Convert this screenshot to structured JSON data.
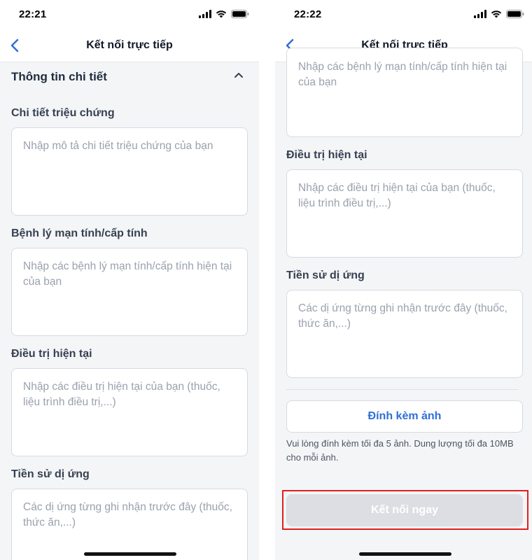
{
  "left": {
    "status": {
      "time": "22:21"
    },
    "nav": {
      "title": "Kết nối trực tiếp"
    },
    "section": {
      "title": "Thông tin chi tiết"
    },
    "fields": [
      {
        "label": "Chi tiết triệu chứng",
        "placeholder": "Nhập mô tả chi tiết triệu chứng của bạn"
      },
      {
        "label": "Bệnh lý mạn tính/cấp tính",
        "placeholder": "Nhập các bệnh lý mạn tính/cấp tính hiện tại của bạn"
      },
      {
        "label": "Điều trị hiện tại",
        "placeholder": "Nhập các điều trị hiện tại của bạn (thuốc, liệu trình điều trị,...)"
      },
      {
        "label": "Tiền sử dị ứng",
        "placeholder": "Các dị ứng từng ghi nhận trước đây (thuốc, thức ăn,...)"
      }
    ]
  },
  "right": {
    "status": {
      "time": "22:22"
    },
    "nav": {
      "title": "Kết nối trực tiếp"
    },
    "partial_placeholder": "Nhập các bệnh lý mạn tính/cấp tính hiện tại của bạn",
    "fields": [
      {
        "label": "Điều trị hiện tại",
        "placeholder": "Nhập các điều trị hiện tại của bạn (thuốc, liệu trình điều trị,...)"
      },
      {
        "label": "Tiền sử dị ứng",
        "placeholder": "Các dị ứng từng ghi nhận trước đây (thuốc, thức ăn,...)"
      }
    ],
    "attach_label": "Đính kèm ảnh",
    "attach_note": "Vui lòng đính kèm tối đa 5 ảnh. Dung lượng tối đa 10MB cho mỗi ảnh.",
    "submit_label": "Kết nối ngay"
  },
  "colors": {
    "accent": "#2f6fd6",
    "highlight": "#e01f1f",
    "disabled_button": "#dcdee3"
  },
  "icons": [
    "back-chevron-icon",
    "chevron-up-icon",
    "signal-icon",
    "wifi-icon",
    "battery-icon"
  ]
}
